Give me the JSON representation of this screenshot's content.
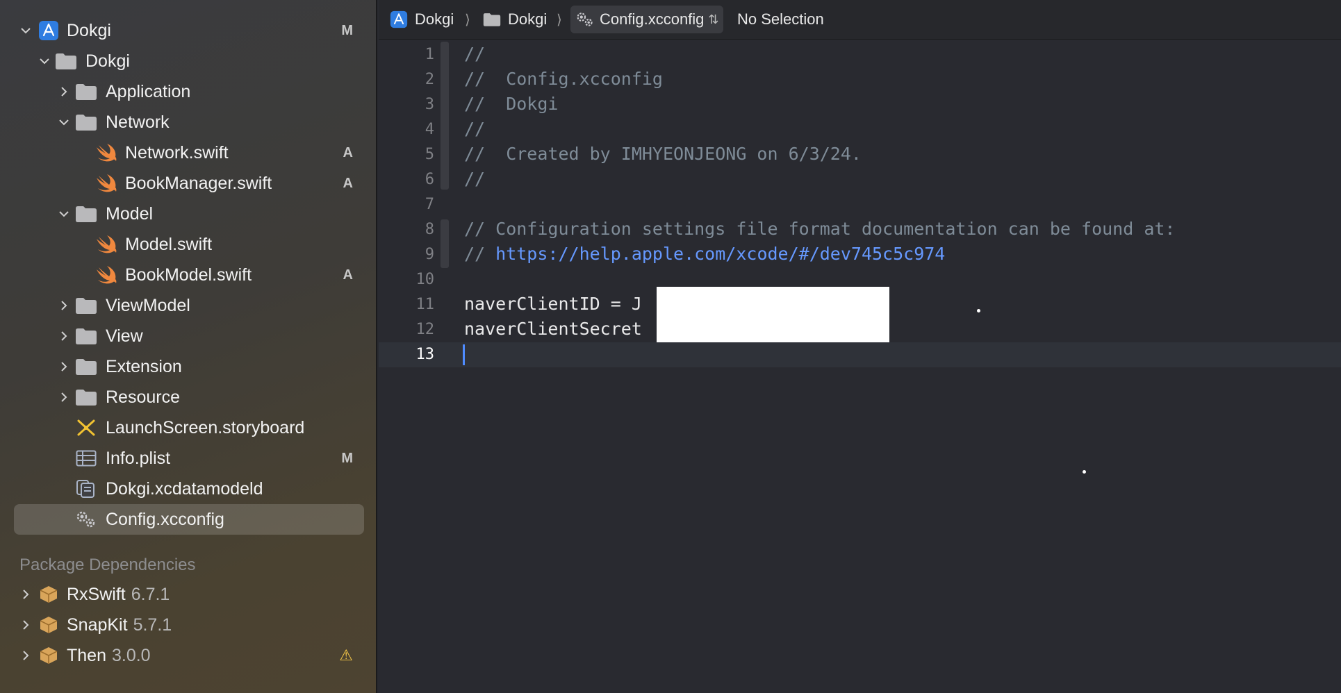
{
  "navigator": {
    "project": {
      "name": "Dokgi",
      "badge": "M"
    },
    "group_root": {
      "name": "Dokgi"
    },
    "items": [
      {
        "name": "Application"
      },
      {
        "name": "Network"
      },
      {
        "name": "Network.swift",
        "badge": "A"
      },
      {
        "name": "BookManager.swift",
        "badge": "A"
      },
      {
        "name": "Model"
      },
      {
        "name": "Model.swift"
      },
      {
        "name": "BookModel.swift",
        "badge": "A"
      },
      {
        "name": "ViewModel"
      },
      {
        "name": "View"
      },
      {
        "name": "Extension"
      },
      {
        "name": "Resource"
      },
      {
        "name": "LaunchScreen.storyboard"
      },
      {
        "name": "Info.plist",
        "badge": "M"
      },
      {
        "name": "Dokgi.xcdatamodeld"
      },
      {
        "name": "Config.xcconfig"
      }
    ],
    "package_section_title": "Package Dependencies",
    "packages": [
      {
        "name": "RxSwift",
        "version": "6.7.1"
      },
      {
        "name": "SnapKit",
        "version": "5.7.1"
      },
      {
        "name": "Then",
        "version": "3.0.0",
        "warning": "⚠"
      }
    ]
  },
  "jumpbar": {
    "project": "Dokgi",
    "group": "Dokgi",
    "file": "Config.xcconfig",
    "selection": "No Selection"
  },
  "editor": {
    "line_numbers": [
      "1",
      "2",
      "3",
      "4",
      "5",
      "6",
      "7",
      "8",
      "9",
      "10",
      "11",
      "12",
      "13"
    ],
    "lines": [
      "//",
      "//  Config.xcconfig",
      "//  Dokgi",
      "//",
      "//  Created by IMHYEONJEONG on 6/3/24.",
      "//",
      "",
      "// Configuration settings file format documentation can be found at:",
      "// ",
      "",
      "naverClientID = J",
      "naverClientSecret",
      ""
    ],
    "link_text": "https://help.apple.com/xcode/#/dev745c5c974",
    "current_line": 13
  },
  "colors": {
    "accent": "#4f8cff",
    "comment": "#7f8c98",
    "link": "#6699ff",
    "swift": "#f0883e",
    "folder": "#b9b9bb"
  }
}
